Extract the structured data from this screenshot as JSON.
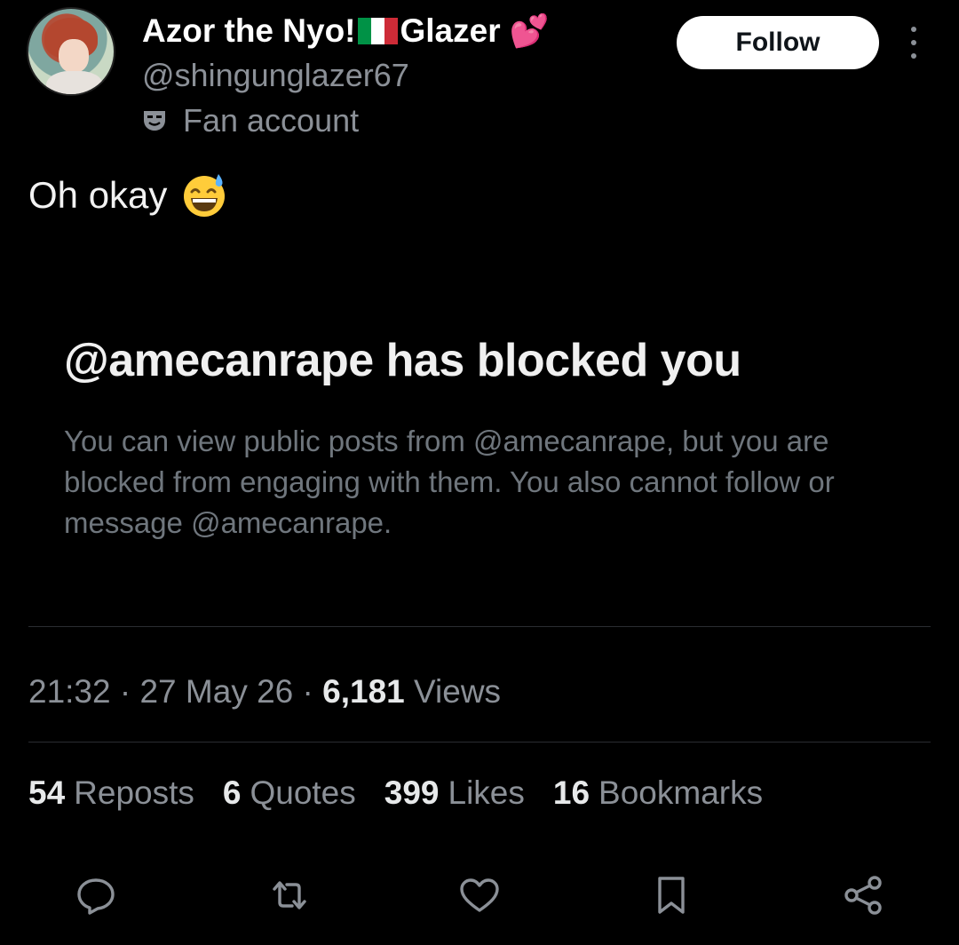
{
  "author": {
    "name_prefix": "Azor the Nyo!",
    "name_suffix": "Glazer",
    "handle": "@shingunglazer67",
    "label": "Fan account",
    "follow_label": "Follow"
  },
  "tweet": {
    "text": "Oh okay"
  },
  "blocked_notice": {
    "title": "@amecanrape has blocked you",
    "body": "You can view public posts from @amecanrape, but you are blocked from engaging with them. You also cannot follow or message @amecanrape."
  },
  "meta": {
    "time": "21:32",
    "date": "27 May 26",
    "views_count": "6,181",
    "views_label": "Views"
  },
  "stats": {
    "reposts_count": "54",
    "reposts_label": "Reposts",
    "quotes_count": "6",
    "quotes_label": "Quotes",
    "likes_count": "399",
    "likes_label": "Likes",
    "bookmarks_count": "16",
    "bookmarks_label": "Bookmarks"
  },
  "colors": {
    "background": "#000000",
    "muted_text": "#8b9097",
    "follow_button_bg": "#ffffff",
    "flag_green": "#009246",
    "flag_white": "#ffffff",
    "flag_red": "#ce2b37"
  },
  "icons": [
    "mask-icon",
    "sweat-smile-emoji",
    "more-icon",
    "reply-icon",
    "repost-icon",
    "like-icon",
    "bookmark-icon",
    "share-icon"
  ]
}
